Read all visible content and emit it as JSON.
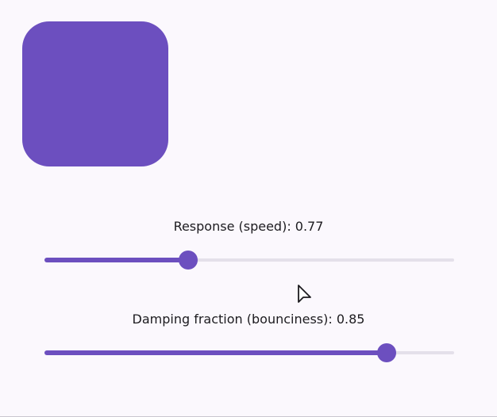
{
  "colors": {
    "accent": "#6c4fbf",
    "track": "#e4e0ea"
  },
  "animated_square": {
    "description_icon": "rounded-square"
  },
  "response": {
    "label": "Response (speed): 0.77",
    "fraction": 0.35
  },
  "damping": {
    "label": "Damping fraction (bounciness): 0.85",
    "fraction": 0.835
  },
  "cursor_icon": "pointer-cursor-icon"
}
